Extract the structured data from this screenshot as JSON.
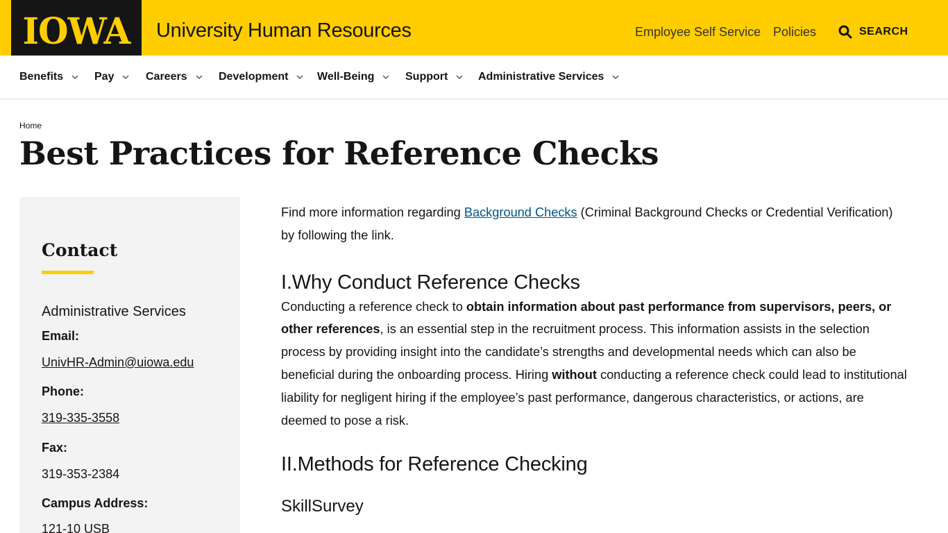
{
  "header": {
    "logo": "IOWA",
    "site_title": "University Human Resources",
    "utility_links": [
      "Employee Self Service",
      "Policies"
    ],
    "search_label": "SEARCH",
    "brand_color": "#ffcd00"
  },
  "nav": {
    "items": [
      "Benefits",
      "Pay",
      "Careers",
      "Development",
      "Well-Being",
      "Support",
      "Administrative Services"
    ]
  },
  "breadcrumb": "Home",
  "page_title": "Best Practices for Reference Checks",
  "sidebar": {
    "heading": "Contact",
    "department": "Administrative Services",
    "email_label": "Email:",
    "email": "UnivHR-Admin@uiowa.edu",
    "phone_label": "Phone:",
    "phone": "319-335-3558",
    "fax_label": "Fax:",
    "fax": "319-353-2384",
    "address_label": "Campus Address:",
    "address": "121-10 USB"
  },
  "main": {
    "intro_before": "Find more information regarding ",
    "intro_link": "Background Checks",
    "intro_after": " (Criminal Background Checks or Credential Verification) by following the link.",
    "section1_heading": "I.Why Conduct Reference Checks",
    "s1_a": "Conducting a reference check to ",
    "s1_b": "obtain information about past performance from supervisors, peers, or other references",
    "s1_c": ", is an essential step in the recruitment process. This information assists in the selection process by providing insight into the candidate’s strengths and developmental needs which can also be beneficial during the onboarding process. Hiring ",
    "s1_d": "without",
    "s1_e": " conducting a reference check could lead to institutional liability for negligent hiring if the employee’s past performance, dangerous characteristics, or actions, are deemed to pose a risk.",
    "section2_heading": "II.Methods for Reference Checking",
    "subsection_heading": "SkillSurvey"
  }
}
